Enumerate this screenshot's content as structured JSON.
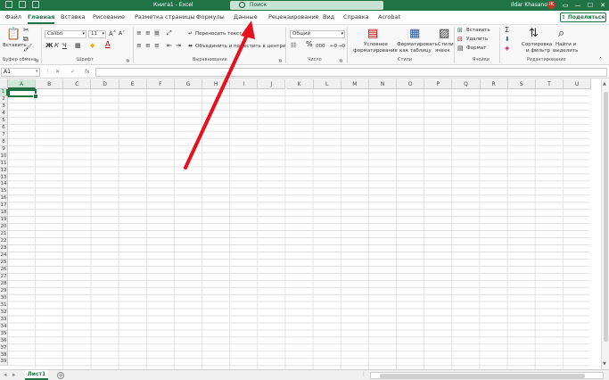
{
  "window": {
    "title": "Книга1  -  Excel",
    "search_placeholder": "Поиск",
    "user_name": "Ildar Khasanov",
    "user_initials": "IK",
    "minimize": "—",
    "restore": "☐",
    "close": "✕"
  },
  "tabs": [
    {
      "label": "Файл"
    },
    {
      "label": "Главная"
    },
    {
      "label": "Вставка"
    },
    {
      "label": "Рисование"
    },
    {
      "label": "Разметка страницы"
    },
    {
      "label": "Формулы"
    },
    {
      "label": "Данные"
    },
    {
      "label": "Рецензирование"
    },
    {
      "label": "Вид"
    },
    {
      "label": "Справка"
    },
    {
      "label": "Acrobat"
    }
  ],
  "active_tab": "Главная",
  "share_label": "Поделиться",
  "ribbon": {
    "clipboard": {
      "paste_label": "Вставить",
      "group_label": "Буфер обмена"
    },
    "font": {
      "font_name": "Calibri",
      "font_size": "11",
      "group_label": "Шрифт",
      "bold": "Ж",
      "italic": "К",
      "underline": "Ч"
    },
    "alignment": {
      "wrap_label": "Переносить текст",
      "merge_label": "Объединить и поместить в центре",
      "group_label": "Выравнивание"
    },
    "number": {
      "format": "Общий",
      "percent": "%",
      "thousands": "000",
      "group_label": "Число"
    },
    "styles": {
      "conditional_label_1": "Условное",
      "conditional_label_2": "форматирование",
      "table_label_1": "Форматировать",
      "table_label_2": "как таблицу",
      "cell_styles_label_1": "Стили",
      "cell_styles_label_2": "ячеек",
      "group_label": "Стили"
    },
    "cells": {
      "insert_label": "Вставить",
      "delete_label": "Удалить",
      "format_label": "Формат",
      "group_label": "Ячейки"
    },
    "editing": {
      "sort_label_1": "Сортировка",
      "sort_label_2": "и фильтр",
      "find_label_1": "Найти и",
      "find_label_2": "выделить",
      "group_label": "Редактирование"
    }
  },
  "formula_bar": {
    "name_box": "A1",
    "fx": "fx",
    "cancel": "✕",
    "enter": "✓",
    "value": ""
  },
  "columns": [
    "A",
    "B",
    "C",
    "D",
    "E",
    "F",
    "G",
    "H",
    "I",
    "J",
    "K",
    "L",
    "M",
    "N",
    "O",
    "P",
    "Q",
    "R",
    "S",
    "T",
    "U"
  ],
  "rows": [
    "1",
    "2",
    "3",
    "4",
    "5",
    "6",
    "7",
    "8",
    "9",
    "10",
    "11",
    "12",
    "13",
    "14",
    "15",
    "16",
    "17",
    "18",
    "19",
    "20",
    "21",
    "22",
    "23",
    "24",
    "25",
    "26",
    "27",
    "28",
    "29",
    "30",
    "31",
    "32",
    "33",
    "34",
    "35",
    "36",
    "37",
    "38",
    "39"
  ],
  "selected_cell": "A1",
  "sheets": [
    {
      "name": "Лист1"
    }
  ],
  "colors": {
    "accent": "#217346",
    "arrow": "#e8101e"
  },
  "annotation": {
    "type": "arrow",
    "points_to": "Данные"
  }
}
